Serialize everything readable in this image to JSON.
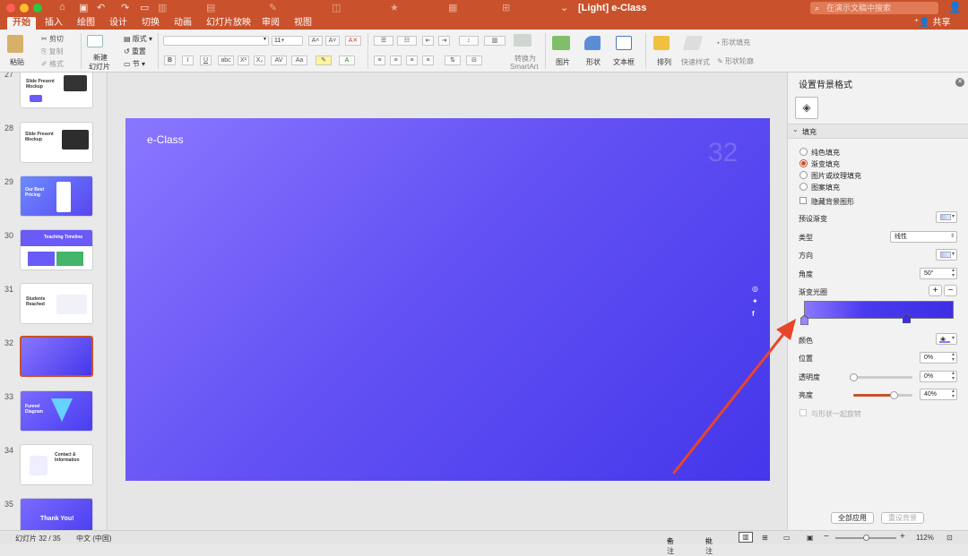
{
  "window": {
    "title": "[Light] e-Class",
    "search_placeholder": "在演示文稿中搜索"
  },
  "tabs": [
    "开始",
    "插入",
    "绘图",
    "设计",
    "切换",
    "动画",
    "幻灯片放映",
    "审阅",
    "视图"
  ],
  "share_label": "共享",
  "ribbon": {
    "paste": "粘贴",
    "cut": "剪切",
    "copy": "复制",
    "format": "格式",
    "new_slide_line1": "新建",
    "new_slide_line2": "幻灯片",
    "layout": "版式",
    "reset": "重置",
    "section": "节",
    "font_size": "11+",
    "smartart_line1": "转换为",
    "smartart_line2": "SmartArt",
    "picture": "图片",
    "shape": "形状",
    "textbox": "文本框",
    "arrange": "排列",
    "quick_style": "快速样式",
    "shape_fill": "形状填充",
    "shape_outline": "形状轮廓"
  },
  "thumbnails": [
    {
      "num": "27",
      "title": "Slide Present Mockup"
    },
    {
      "num": "28",
      "title": "Slide Present Mockup"
    },
    {
      "num": "29",
      "title": "Our Best Pricing"
    },
    {
      "num": "30",
      "title": "Teaching Timeline"
    },
    {
      "num": "31",
      "title": "Students Reached"
    },
    {
      "num": "32",
      "title": ""
    },
    {
      "num": "33",
      "title": "Funnel Diagram"
    },
    {
      "num": "34",
      "title": "Contact & Information"
    },
    {
      "num": "35",
      "title": "Thank You!"
    }
  ],
  "slide": {
    "title": "e-Class",
    "number": "32"
  },
  "panel": {
    "title": "设置背景格式",
    "section": "填充",
    "options": [
      "纯色填充",
      "渐变填充",
      "图片或纹理填充",
      "图案填充"
    ],
    "selected_option": "渐变填充",
    "hide_bg": "隐藏背景图形",
    "preset": "预设渐变",
    "type_label": "类型",
    "type_value": "线性",
    "direction": "方向",
    "angle_label": "角度",
    "angle_value": "50°",
    "stops_label": "渐变光圈",
    "color_label": "颜色",
    "position_label": "位置",
    "position_value": "0%",
    "transparency_label": "透明度",
    "transparency_value": "0%",
    "brightness_label": "亮度",
    "brightness_value": "40%",
    "rotate_with_shape": "与形状一起旋转",
    "apply_all": "全部应用",
    "reset_bg": "重设背景"
  },
  "status": {
    "slide_count": "幻灯片 32 / 35",
    "language": "中文 (中国)",
    "notes": "备注",
    "comments": "批注",
    "zoom": "112%"
  },
  "colors": {
    "accent": "#c9512b",
    "slide_start": "#8a77ff",
    "slide_end": "#4437ea"
  }
}
